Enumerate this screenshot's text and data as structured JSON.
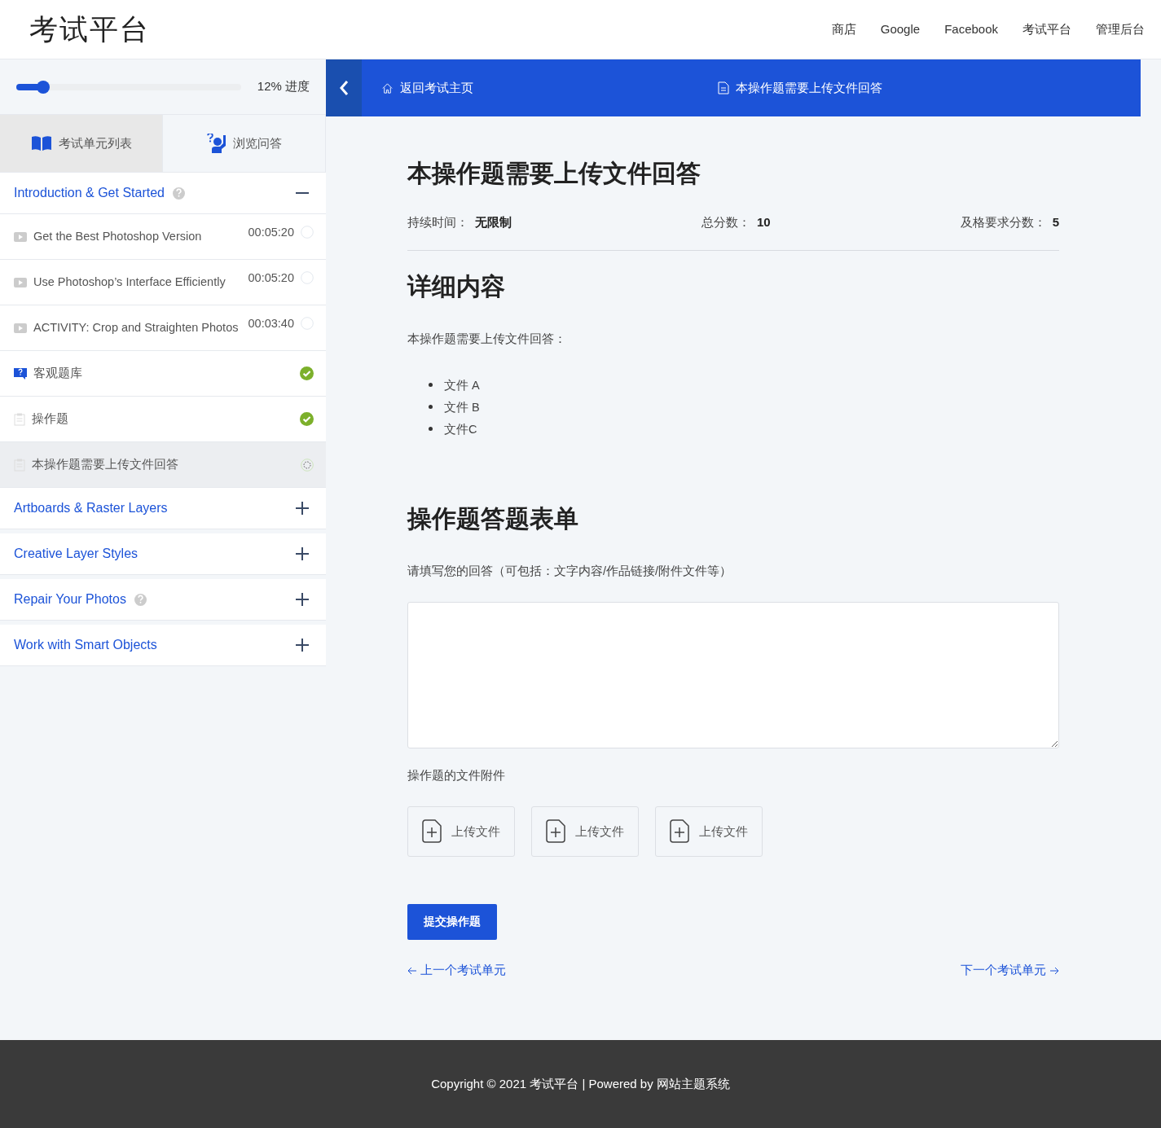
{
  "header": {
    "logo": "考试平台",
    "nav": [
      "商店",
      "Google",
      "Facebook",
      "考试平台",
      "管理后台"
    ]
  },
  "sidebar": {
    "progress": {
      "level": 0.12,
      "label": "12% 进度"
    },
    "tabs": [
      {
        "label": "考试单元列表",
        "kind": "book",
        "selected": true
      },
      {
        "label": "浏览问答",
        "kind": "question",
        "selected": false
      }
    ],
    "sections": [
      {
        "title": "Introduction & Get Started",
        "help": true,
        "expanded": true,
        "items": [
          {
            "kind": "video",
            "title": "Get the Best Photoshop Version",
            "duration": "00:05:20",
            "complete": false,
            "started": false,
            "selected": false
          },
          {
            "kind": "video",
            "title": "Use Photoshop’s Interface Efficiently",
            "duration": "00:05:20",
            "complete": false,
            "started": false,
            "selected": false
          },
          {
            "kind": "video",
            "title": "ACTIVITY: Crop and Straighten Photos",
            "duration": "00:03:40",
            "complete": false,
            "started": false,
            "selected": false
          },
          {
            "kind": "quiz",
            "title": "客观题库",
            "complete": true,
            "selected": false
          },
          {
            "kind": "assignment",
            "title": "操作题",
            "complete": true,
            "selected": false
          },
          {
            "kind": "assignment",
            "title": "本操作题需要上传文件回答",
            "complete": false,
            "started": true,
            "selected": true
          }
        ]
      },
      {
        "title": "Artboards & Raster Layers",
        "help": false,
        "expanded": false
      },
      {
        "title": "Creative Layer Styles",
        "help": false,
        "expanded": false
      },
      {
        "title": "Repair Your Photos",
        "help": true,
        "expanded": false
      },
      {
        "title": "Work with Smart Objects",
        "help": false,
        "expanded": false
      }
    ]
  },
  "topbar": {
    "back": "返回考试主页",
    "current": "本操作题需要上传文件回答"
  },
  "main": {
    "title": "本操作题需要上传文件回答",
    "meta": [
      {
        "label": "持续时间：",
        "value": "无限制"
      },
      {
        "label": "总分数：",
        "value": "10"
      },
      {
        "label": "及格要求分数：",
        "value": "5"
      }
    ],
    "details_heading": "详细内容",
    "intro": "本操作题需要上传文件回答：",
    "files": [
      "文件 A",
      "文件 B",
      "文件C"
    ],
    "form_heading": "操作题答题表单",
    "prompt": "请填写您的回答（可包括：文字内容/作品链接/附件文件等）",
    "attachments_label": "操作题的文件附件",
    "uploads": [
      "上传文件",
      "上传文件",
      "上传文件"
    ],
    "submit": "提交操作题",
    "prev": "上一个考试单元",
    "next": "下一个考试单元"
  },
  "footer": "Copyright © 2021 考试平台 | Powered by 网站主题系统"
}
